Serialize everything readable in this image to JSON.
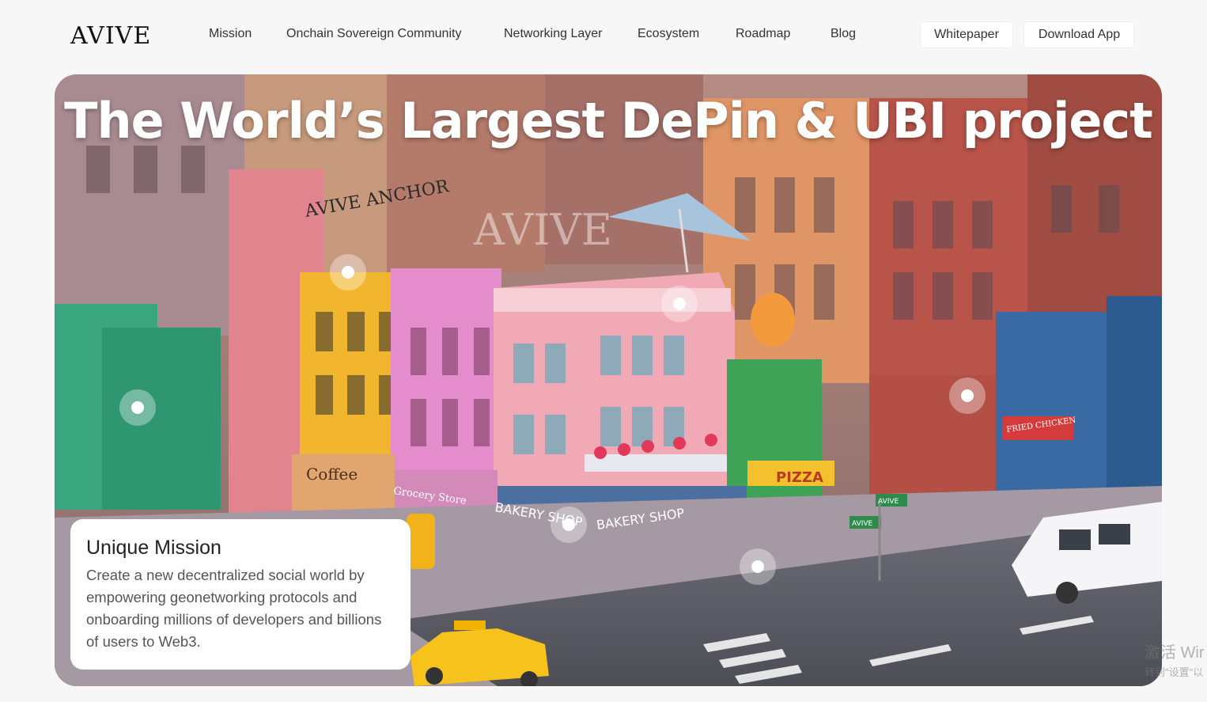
{
  "logo": {
    "text": "AVIVE"
  },
  "nav": {
    "items": [
      {
        "label": "Mission"
      },
      {
        "label": "Onchain Sovereign Community"
      },
      {
        "label": "Networking Layer"
      },
      {
        "label": "Ecosystem"
      },
      {
        "label": "Roadmap"
      },
      {
        "label": "Blog"
      }
    ]
  },
  "buttons": {
    "whitepaper": "Whitepaper",
    "download": "Download App"
  },
  "hero": {
    "title": "The World’s Largest DePin & UBI project",
    "scene_signs": {
      "graffiti": "AVIVE ANCHOR",
      "coffee": "Coffee",
      "grocery": "Grocery Store",
      "bakery1": "BAKERY SHOP",
      "bakery2": "BAKERY SHOP",
      "pizza": "PIZZA",
      "chicken": "FRIED CHICKEN",
      "street1": "AVIVE",
      "street2": "AVIVE",
      "rooftop_logo": "AVIVE"
    }
  },
  "mission_card": {
    "title": "Unique Mission",
    "text": "Create a new decentralized social world by empowering geonetworking protocols and onboarding millions of developers and billions of users to Web3."
  },
  "watermark": {
    "line1": "激活 Wir",
    "line2": "转到\"设置\"以"
  },
  "colors": {
    "background": "#f7f7f7",
    "card": "#ffffff",
    "title": "#ffffff"
  }
}
